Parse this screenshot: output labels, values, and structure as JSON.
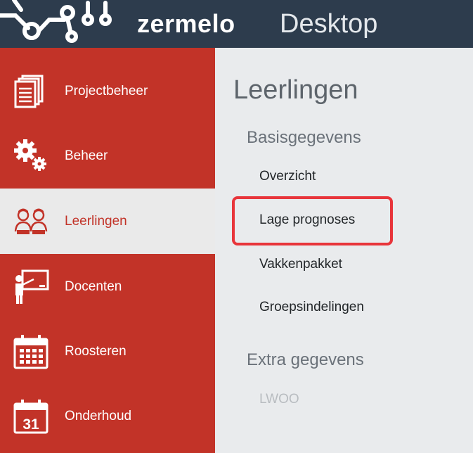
{
  "header": {
    "brand": "zermelo",
    "product": "Desktop",
    "logo_icon": "circuit-logo-icon"
  },
  "sidebar": {
    "items": [
      {
        "label": "Projectbeheer",
        "icon": "documents-icon"
      },
      {
        "label": "Beheer",
        "icon": "gears-icon"
      },
      {
        "label": "Leerlingen",
        "icon": "students-icon",
        "active": true
      },
      {
        "label": "Docenten",
        "icon": "teacher-board-icon"
      },
      {
        "label": "Roosteren",
        "icon": "calendar-grid-icon"
      },
      {
        "label": "Onderhoud",
        "icon": "calendar-31-icon",
        "icon_text": "31"
      }
    ]
  },
  "main": {
    "title": "Leerlingen",
    "sections": [
      {
        "title": "Basisgegevens",
        "items": [
          "Overzicht",
          "Lage prognoses",
          "Vakkenpakket",
          "Groepsindelingen"
        ]
      },
      {
        "title": "Extra gegevens",
        "items": [
          "LWOO"
        ]
      }
    ]
  },
  "colors": {
    "header_bg": "#2d3c4d",
    "sidebar_red": "#c23328",
    "active_bg": "#eaeaea",
    "content_bg": "#e9ebed",
    "highlight_border": "#e8353b"
  }
}
